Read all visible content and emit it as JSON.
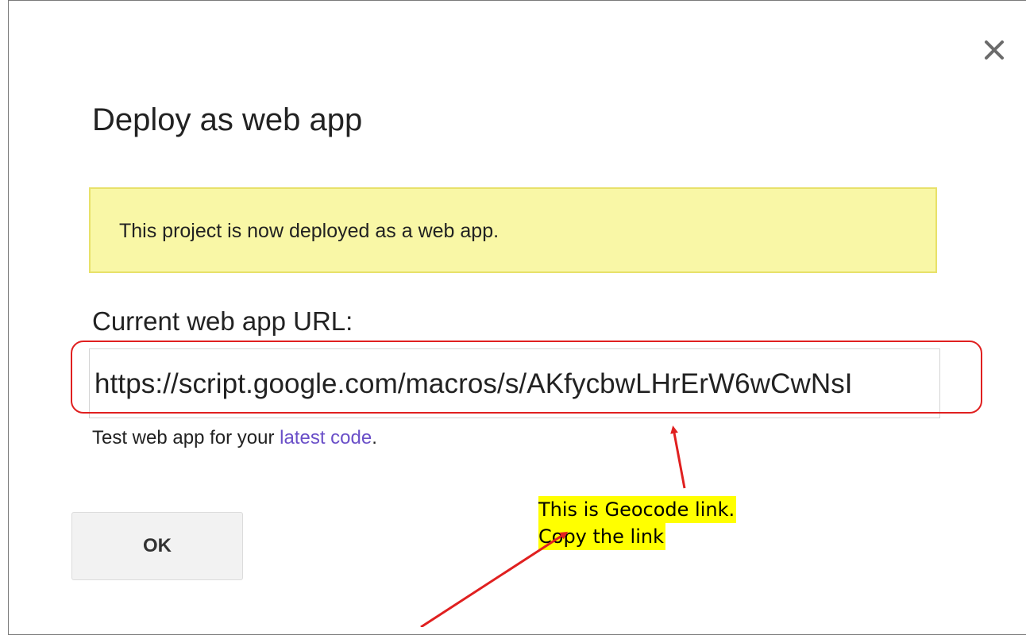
{
  "dialog": {
    "title": "Deploy as web app",
    "close_icon": "close-icon",
    "notice": "This project is now deployed as a web app.",
    "url_label": "Current web app URL:",
    "url_value": "https://script.google.com/macros/s/AKfycbwLHrErW6wCwNsI",
    "test_prefix": "Test web app for your ",
    "test_link": "latest code",
    "test_suffix": ".",
    "ok_label": "OK"
  },
  "annotation": {
    "line1": "This is Geocode link.",
    "line2": "Copy the link",
    "highlight_color": "#ffff00",
    "marker_color": "#e02020"
  },
  "colors": {
    "notice_bg": "#f9f7a6",
    "notice_border": "#e8e16a",
    "link": "#6a4fc8"
  }
}
